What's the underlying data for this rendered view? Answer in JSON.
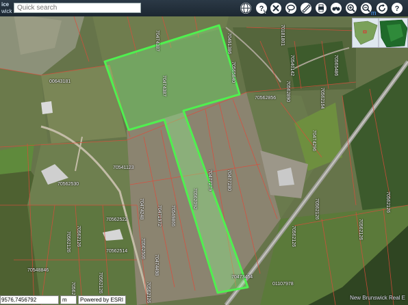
{
  "brand": {
    "line1": "ice",
    "line2": "wick"
  },
  "search": {
    "placeholder": "Quick search"
  },
  "toolbar": {
    "icons": [
      "globe-icon",
      "identify-icon",
      "close-icon",
      "lasso-select-icon",
      "measure-icon",
      "print-icon",
      "binoculars-icon",
      "zoom-in-icon",
      "zoom-out-icon",
      "refresh-icon",
      "help-icon"
    ],
    "unit_hint": "m"
  },
  "parcel_labels": [
    "70474387",
    "70491386",
    "70181801",
    "70565840",
    "70540142",
    "70565486",
    "00643181",
    "70562890",
    "70562856",
    "70562164",
    "70474387",
    "70474296",
    "70541123",
    "70562530",
    "70477279",
    "70477280",
    "70549866",
    "70562092",
    "70562522",
    "70471972",
    "70474248",
    "70562514",
    "70562506",
    "70548846",
    "70562126",
    "70562126",
    "70562126",
    "70474498",
    "70562126",
    "70562126",
    "70562126",
    "70562126",
    "70562126",
    "70562126",
    "70473454",
    "01107978"
  ],
  "status": {
    "coordinates": "9576,7456792",
    "unit": "m",
    "powered_by": "Powered by ESRI",
    "credit": "New Brunswick Real E"
  },
  "colors": {
    "selected_parcel": "#4ff04f",
    "parcel_lines": "#e04a3a",
    "toolbar": "#1f2b36"
  }
}
